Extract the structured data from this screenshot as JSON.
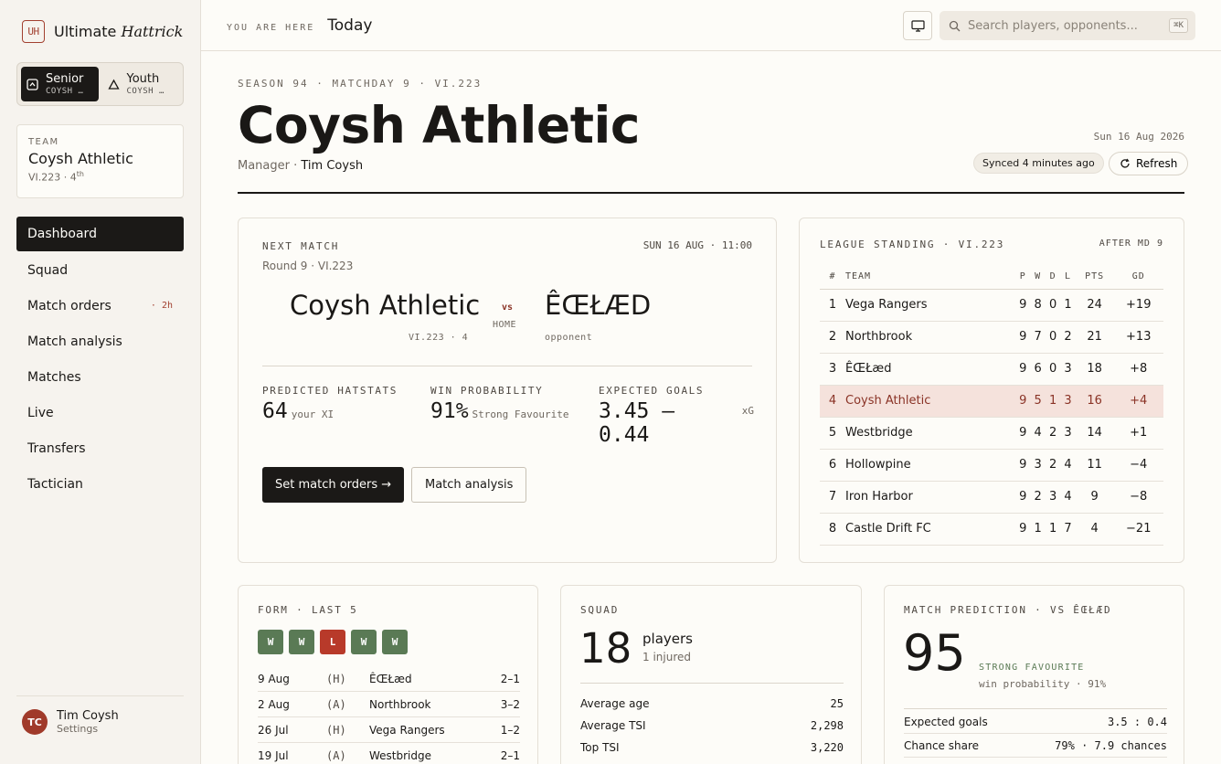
{
  "brand": {
    "logo": "UH",
    "name": "Ultimate",
    "name_italic": "Hattrick"
  },
  "switcher": {
    "senior": {
      "label": "Senior",
      "sub": "COYSH …"
    },
    "youth": {
      "label": "Youth",
      "sub": "COYSH …"
    }
  },
  "team_card": {
    "label": "TEAM",
    "name": "Coysh Athletic",
    "sub": "VI.223 · 4",
    "sup": "th"
  },
  "nav": {
    "dashboard": "Dashboard",
    "squad": "Squad",
    "match_orders": "Match orders",
    "match_orders_badge": "· 2h",
    "match_analysis": "Match analysis",
    "matches": "Matches",
    "live": "Live",
    "transfers": "Transfers",
    "tactician": "Tactician"
  },
  "user": {
    "initials": "TC",
    "name": "Tim Coysh",
    "sub": "Settings"
  },
  "topbar": {
    "you_are_here": "YOU ARE HERE",
    "page": "Today",
    "search_placeholder": "Search players, opponents...",
    "search_kbd": "⌘K"
  },
  "header": {
    "meta": "SEASON 94 · MATCHDAY 9 · VI.223",
    "title": "Coysh Athletic",
    "manager_label": "Manager ·",
    "manager_name": "Tim Coysh",
    "date": "Sun 16 Aug 2026",
    "synced": "Synced 4 minutes ago",
    "refresh": "Refresh"
  },
  "next_match": {
    "label": "NEXT MATCH",
    "date": "SUN 16 AUG · 11:00",
    "round": "Round 9 · VI.223",
    "home": "Coysh Athletic",
    "home_sub": "VI.223 · 4",
    "vs": "vs",
    "venue": "HOME",
    "away": "ÊŒŁÆD",
    "away_sub": "opponent",
    "stats": [
      {
        "label": "PREDICTED HATSTATS",
        "value": "64",
        "note": "your XI"
      },
      {
        "label": "WIN PROBABILITY",
        "value": "91%",
        "note": "Strong Favourite"
      },
      {
        "label": "EXPECTED GOALS",
        "value": "3.45 — 0.44",
        "note": "xG"
      }
    ],
    "btn_orders": "Set match orders →",
    "btn_analysis": "Match analysis"
  },
  "league": {
    "label": "LEAGUE STANDING · VI.223",
    "after": "AFTER MD 9",
    "headers": [
      "#",
      "TEAM",
      "P",
      "W",
      "D",
      "L",
      "PTS",
      "GD"
    ],
    "rows": [
      {
        "rank": "1",
        "team": "Vega Rangers",
        "p": "9",
        "w": "8",
        "d": "0",
        "l": "1",
        "pts": "24",
        "gd": "+19"
      },
      {
        "rank": "2",
        "team": "Northbrook",
        "p": "9",
        "w": "7",
        "d": "0",
        "l": "2",
        "pts": "21",
        "gd": "+13"
      },
      {
        "rank": "3",
        "team": "ÊŒŁæd",
        "p": "9",
        "w": "6",
        "d": "0",
        "l": "3",
        "pts": "18",
        "gd": "+8"
      },
      {
        "rank": "4",
        "team": "Coysh Athletic",
        "p": "9",
        "w": "5",
        "d": "1",
        "l": "3",
        "pts": "16",
        "gd": "+4"
      },
      {
        "rank": "5",
        "team": "Westbridge",
        "p": "9",
        "w": "4",
        "d": "2",
        "l": "3",
        "pts": "14",
        "gd": "+1"
      },
      {
        "rank": "6",
        "team": "Hollowpine",
        "p": "9",
        "w": "3",
        "d": "2",
        "l": "4",
        "pts": "11",
        "gd": "−4"
      },
      {
        "rank": "7",
        "team": "Iron Harbor",
        "p": "9",
        "w": "2",
        "d": "3",
        "l": "4",
        "pts": "9",
        "gd": "−8"
      },
      {
        "rank": "8",
        "team": "Castle Drift FC",
        "p": "9",
        "w": "1",
        "d": "1",
        "l": "7",
        "pts": "4",
        "gd": "−21"
      }
    ]
  },
  "form": {
    "label": "FORM · LAST 5",
    "chips": [
      "W",
      "W",
      "L",
      "W",
      "W"
    ],
    "fixtures": [
      {
        "date": "9 Aug",
        "venue": "(H)",
        "opp": "ÊŒŁæd",
        "score": "2–1"
      },
      {
        "date": "2 Aug",
        "venue": "(A)",
        "opp": "Northbrook",
        "score": "3–2"
      },
      {
        "date": "26 Jul",
        "venue": "(H)",
        "opp": "Vega Rangers",
        "score": "1–2"
      },
      {
        "date": "19 Jul",
        "venue": "(A)",
        "opp": "Westbridge",
        "score": "2–1"
      }
    ]
  },
  "squad": {
    "label": "SQUAD",
    "count": "18",
    "unit": "players",
    "injured": "1 injured",
    "stats": [
      {
        "k": "Average age",
        "v": "25"
      },
      {
        "k": "Average TSI",
        "v": "2,298"
      },
      {
        "k": "Top TSI",
        "v": "3,220"
      }
    ]
  },
  "prediction": {
    "label": "MATCH PREDICTION · VS ÊŒŁÆD",
    "value": "95",
    "tag": "STRONG FAVOURITE",
    "sub": "win probability · 91%",
    "stats": [
      {
        "k": "Expected goals",
        "v": "3.5 : 0.4"
      },
      {
        "k": "Chance share",
        "v": "79% · 7.9 chances"
      }
    ]
  },
  "colors": {
    "accent": "#a24030",
    "dark": "#1b1917",
    "win": "#5a7a55",
    "loss": "#b83a2a",
    "highlight": "#f5e2dc"
  }
}
